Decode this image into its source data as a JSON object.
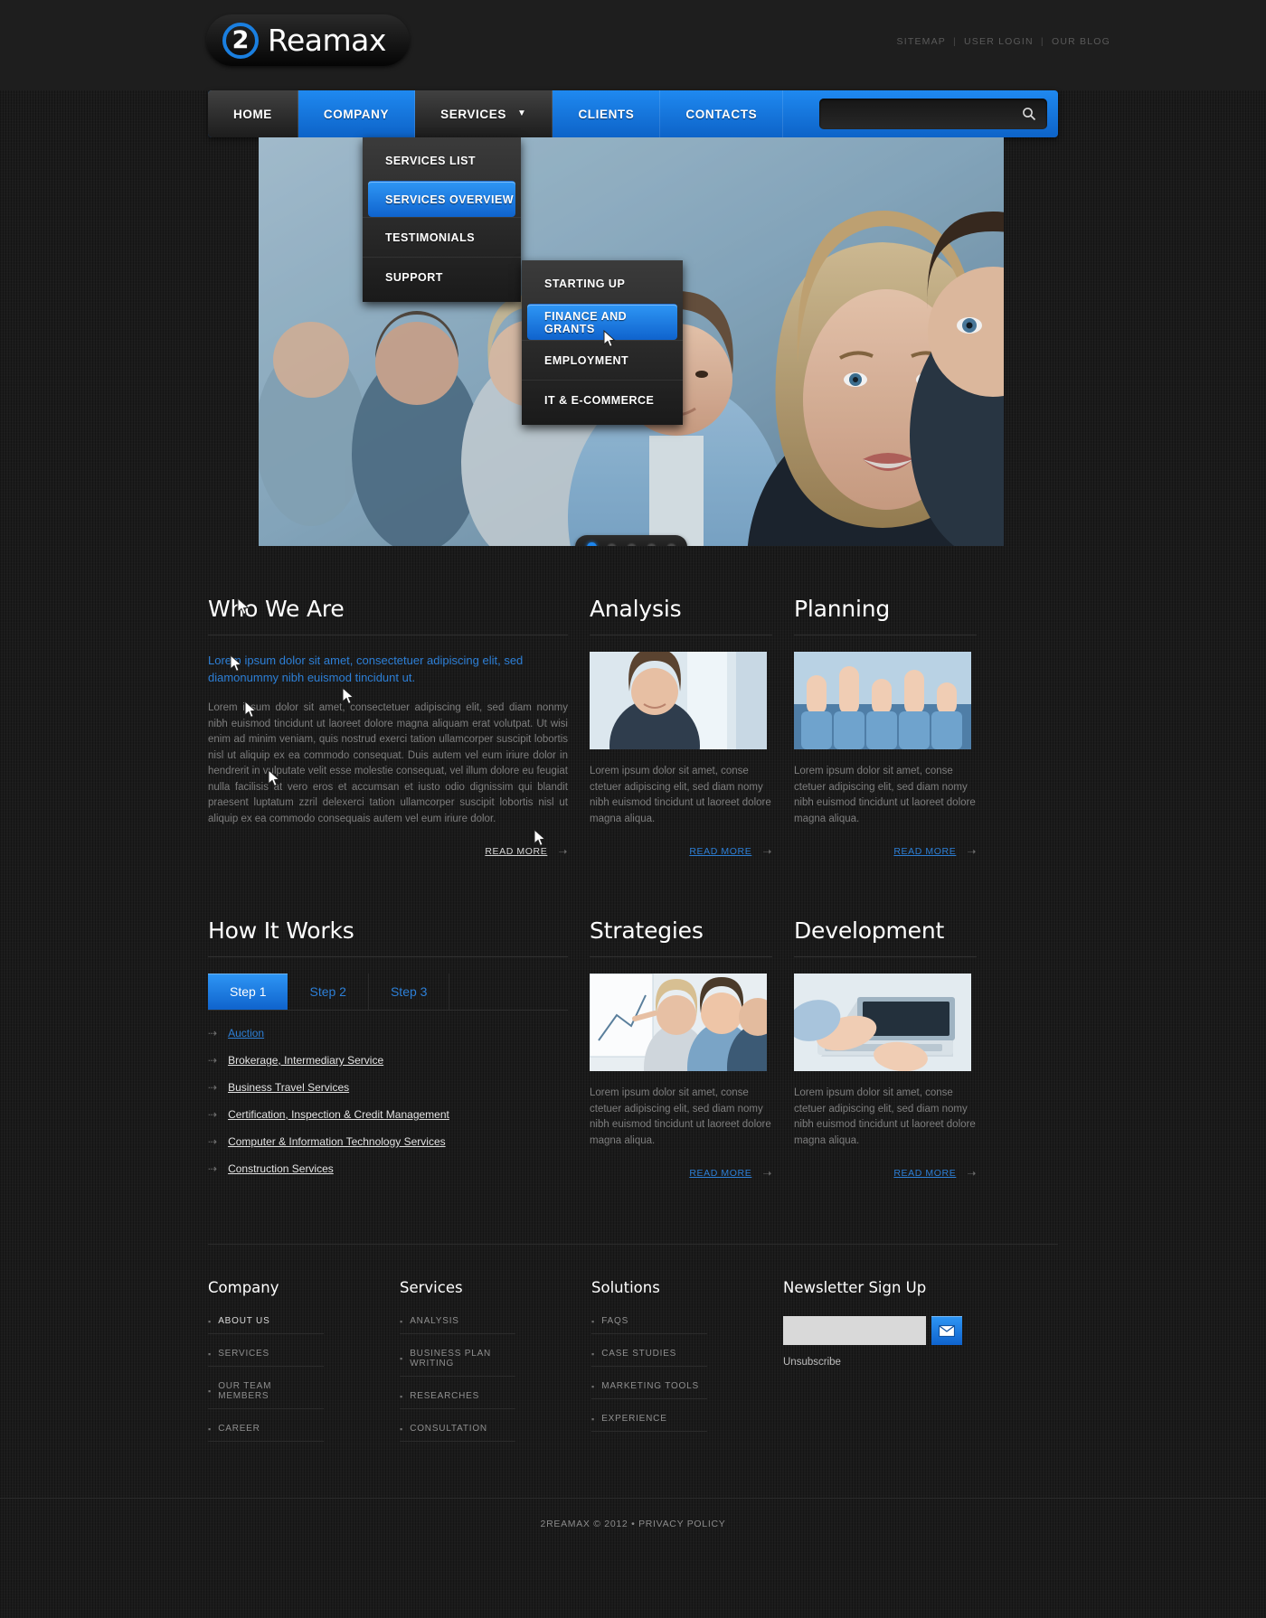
{
  "brand": {
    "mark": "2",
    "name": "Reamax",
    "accent": "#1a7fe0"
  },
  "toplinks": [
    {
      "label": "SITEMAP"
    },
    {
      "label": "USER LOGIN"
    },
    {
      "label": "OUR BLOG"
    }
  ],
  "nav": {
    "items": [
      {
        "label": "HOME",
        "state": "dark"
      },
      {
        "label": "COMPANY",
        "state": "blue"
      },
      {
        "label": "SERVICES",
        "state": "dark",
        "has_chevron": true
      },
      {
        "label": "CLIENTS",
        "state": "blue"
      },
      {
        "label": "CONTACTS",
        "state": "blue"
      }
    ],
    "search": {
      "value": "",
      "placeholder": ""
    }
  },
  "dropdown": {
    "items": [
      {
        "label": "SERVICES LIST",
        "active": false
      },
      {
        "label": "SERVICES OVERVIEW",
        "active": true
      },
      {
        "label": "TESTIMONIALS",
        "active": false
      },
      {
        "label": "SUPPORT",
        "active": false
      }
    ]
  },
  "subdropdown": {
    "items": [
      {
        "label": "STARTING UP",
        "active": false
      },
      {
        "label": "FINANCE AND GRANTS",
        "active": true
      },
      {
        "label": "EMPLOYMENT",
        "active": false
      },
      {
        "label": "IT & E-COMMERCE",
        "active": false
      }
    ]
  },
  "slider": {
    "dots": 5,
    "active_dot": 1
  },
  "sections": {
    "who_we_are": {
      "title": "Who We Are",
      "lead": "Lorem ipsum dolor sit amet, consectetuer adipiscing elit, sed diamonummy nibh euismod tincidunt ut.",
      "body": "Lorem ipsum dolor sit amet, consectetuer adipiscing elit, sed diam nonmy nibh euismod tincidunt ut laoreet dolore magna aliquam erat volutpat. Ut wisi enim ad minim veniam, quis nostrud exerci tation ullamcorper suscipit lobortis nisl ut aliquip ex ea commodo consequat. Duis autem vel eum iriure dolor in hendrerit in vulputate velit esse molestie consequat, vel illum dolore eu feugiat nulla facilisis at vero eros et accumsan et iusto odio dignissim qui blandit praesent luptatum zzril delexerci tation ullamcorper suscipit lobortis nisl ut aliquip ex ea commodo consequais autem vel eum iriure dolor.",
      "read_more": "READ MORE"
    },
    "analysis": {
      "title": "Analysis",
      "body": "Lorem ipsum dolor sit amet, conse ctetuer adipiscing elit, sed diam nomy nibh euismod tincidunt ut laoreet dolore magna aliqua.",
      "read_more": "READ MORE"
    },
    "planning": {
      "title": "Planning",
      "body": "Lorem ipsum dolor sit amet, conse ctetuer adipiscing elit, sed diam nomy nibh euismod tincidunt ut laoreet dolore magna aliqua.",
      "read_more": "READ MORE"
    },
    "how_it_works": {
      "title": "How It Works",
      "tabs": [
        {
          "label": "Step 1",
          "active": true
        },
        {
          "label": "Step 2",
          "active": false
        },
        {
          "label": "Step 3",
          "active": false
        }
      ],
      "links": [
        {
          "label": "Auction",
          "style": "blue"
        },
        {
          "label": "Brokerage, Intermediary Service",
          "style": "white"
        },
        {
          "label": "Business Travel Services",
          "style": "white"
        },
        {
          "label": "Certification, Inspection & Credit Management",
          "style": "white"
        },
        {
          "label": "Computer & Information Technology Services",
          "style": "white"
        },
        {
          "label": "Construction Services",
          "style": "white"
        }
      ]
    },
    "strategies": {
      "title": "Strategies",
      "body": "Lorem ipsum dolor sit amet, conse ctetuer adipiscing elit, sed diam nomy nibh euismod tincidunt ut laoreet dolore magna aliqua.",
      "read_more": "READ MORE"
    },
    "development": {
      "title": "Development",
      "body": "Lorem ipsum dolor sit amet, conse ctetuer adipiscing elit, sed diam nomy nibh euismod tincidunt ut laoreet dolore magna aliqua.",
      "read_more": "READ MORE"
    }
  },
  "footer": {
    "company": {
      "title": "Company",
      "items": [
        "ABOUT US",
        "SERVICES",
        "OUR TEAM MEMBERS",
        "CAREER"
      ]
    },
    "services": {
      "title": "Services",
      "items": [
        "ANALYSIS",
        "BUSINESS PLAN WRITING",
        "RESEARCHES",
        "CONSULTATION"
      ]
    },
    "solutions": {
      "title": "Solutions",
      "items": [
        "FAQS",
        "CASE STUDIES",
        "MARKETING TOOLS",
        "EXPERIENCE"
      ]
    },
    "newsletter": {
      "title": "Newsletter Sign Up",
      "value": "",
      "placeholder": "",
      "button_icon": "envelope-icon",
      "unsubscribe": "Unsubscribe"
    },
    "copyright": "2REAMAX © 2012 • PRIVACY POLICY"
  }
}
